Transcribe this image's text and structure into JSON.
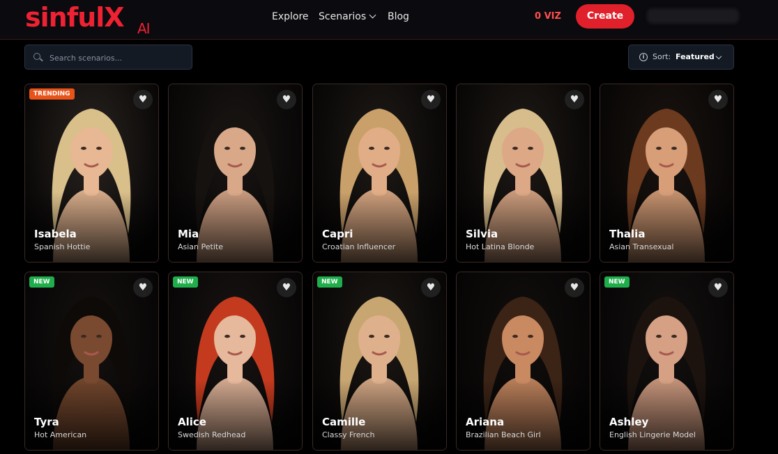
{
  "brand": {
    "logo": "sinfulX",
    "logo_suffix": "AI",
    "accent": "#ee2233"
  },
  "nav": {
    "explore": "Explore",
    "scenarios": "Scenarios",
    "blog": "Blog",
    "viz": "0 VIZ",
    "create": "Create"
  },
  "search": {
    "placeholder": "Search scenarios...",
    "icon": "search-icon"
  },
  "sort": {
    "label": "Sort:",
    "value": "Featured",
    "icon": "info-icon"
  },
  "cards": [
    {
      "name": "Isabela",
      "subtitle": "Spanish Hottie",
      "badge": "TRENDING",
      "hair": "#d9bf8a",
      "skin": "#e7b893",
      "bg": "#2a2420"
    },
    {
      "name": "Mia",
      "subtitle": "Asian Petite",
      "badge": "",
      "hair": "#161210",
      "skin": "#d9a889",
      "bg": "#1a1614"
    },
    {
      "name": "Capri",
      "subtitle": "Croatian Influencer",
      "badge": "",
      "hair": "#c9a06a",
      "skin": "#e0ad86",
      "bg": "#1e1a16"
    },
    {
      "name": "Silvia",
      "subtitle": "Hot Latina Blonde",
      "badge": "",
      "hair": "#d8bd8c",
      "skin": "#dca886",
      "bg": "#1f1a16"
    },
    {
      "name": "Thalia",
      "subtitle": "Asian Transexual",
      "badge": "",
      "hair": "#6b3a1f",
      "skin": "#d79e78",
      "bg": "#1b1410"
    },
    {
      "name": "Tyra",
      "subtitle": "Hot American",
      "badge": "NEW",
      "hair": "#0d0a08",
      "skin": "#7a4a30",
      "bg": "#151110"
    },
    {
      "name": "Alice",
      "subtitle": "Swedish Redhead",
      "badge": "NEW",
      "hair": "#c43a1e",
      "skin": "#e6b89c",
      "bg": "#191413"
    },
    {
      "name": "Camille",
      "subtitle": "Classy French",
      "badge": "NEW",
      "hair": "#c8a672",
      "skin": "#dfb08c",
      "bg": "#1c1814"
    },
    {
      "name": "Ariana",
      "subtitle": "Brazilian Beach Girl",
      "badge": "",
      "hair": "#3b2315",
      "skin": "#c98a62",
      "bg": "#120f0d"
    },
    {
      "name": "Ashley",
      "subtitle": "English Lingerie Model",
      "badge": "NEW",
      "hair": "#1c130e",
      "skin": "#d5a084",
      "bg": "#141110"
    }
  ]
}
